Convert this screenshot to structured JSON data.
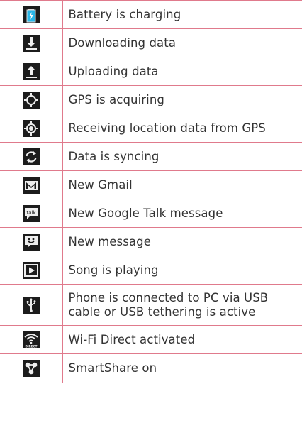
{
  "rows": [
    {
      "icon": "battery-charging-icon",
      "label": "Battery is charging"
    },
    {
      "icon": "download-icon",
      "label": "Downloading data"
    },
    {
      "icon": "upload-icon",
      "label": "Uploading data"
    },
    {
      "icon": "gps-acquiring-icon",
      "label": "GPS is acquiring"
    },
    {
      "icon": "gps-receiving-icon",
      "label": "Receiving location data from GPS"
    },
    {
      "icon": "sync-icon",
      "label": "Data is syncing"
    },
    {
      "icon": "gmail-icon",
      "label": "New Gmail"
    },
    {
      "icon": "google-talk-icon",
      "label": "New Google Talk message"
    },
    {
      "icon": "message-icon",
      "label": "New message"
    },
    {
      "icon": "play-icon",
      "label": "Song is playing"
    },
    {
      "icon": "usb-icon",
      "label": "Phone is connected to PC via USB cable or USB tethering is active"
    },
    {
      "icon": "wifi-direct-icon",
      "label": "Wi-Fi Direct activated",
      "icon_text": "DIRECT"
    },
    {
      "icon": "smartshare-icon",
      "label": "SmartShare on"
    }
  ],
  "icons": {
    "google_talk_text": "talk"
  },
  "colors": {
    "rule": "#e07a8c",
    "icon_bg": "#1c1c1c",
    "battery_fill": "#29b6e8",
    "text": "#333333"
  }
}
